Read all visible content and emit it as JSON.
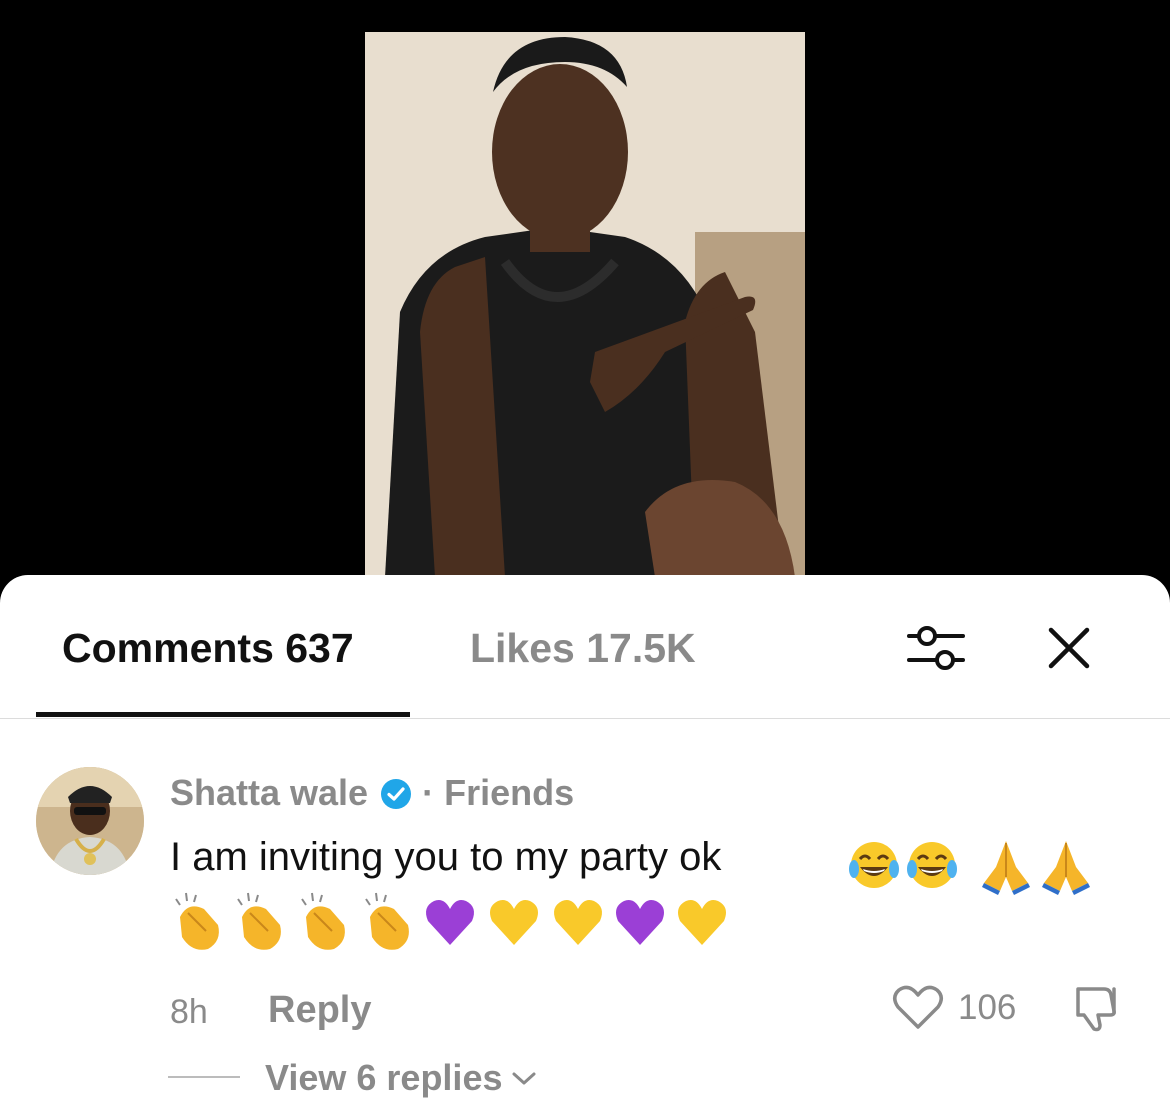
{
  "tabs": {
    "comments_label": "Comments 637",
    "likes_label": "Likes 17.5K"
  },
  "icons": {
    "filter": "sliders-icon",
    "close": "close-icon",
    "verified": "verified-badge-icon",
    "like": "heart-icon",
    "dislike": "thumbs-down-icon",
    "chevron": "chevron-down-icon"
  },
  "comment": {
    "username": "Shatta wale",
    "separator": "·",
    "relation": "Friends",
    "text": "I am inviting you to my party ok",
    "emojis_line1": [
      "face-with-tears-of-joy",
      "face-with-tears-of-joy",
      "folded-hands",
      "folded-hands"
    ],
    "emojis_line2": [
      "clapping-hands",
      "clapping-hands",
      "clapping-hands",
      "clapping-hands",
      "purple-heart",
      "yellow-heart",
      "yellow-heart",
      "purple-heart",
      "yellow-heart"
    ],
    "time": "8h",
    "reply_label": "Reply",
    "like_count": "106",
    "view_replies": "View 6 replies"
  },
  "colors": {
    "muted_text": "#8a8a8a",
    "primary_text": "#111111",
    "verified": "#20a6e8"
  }
}
